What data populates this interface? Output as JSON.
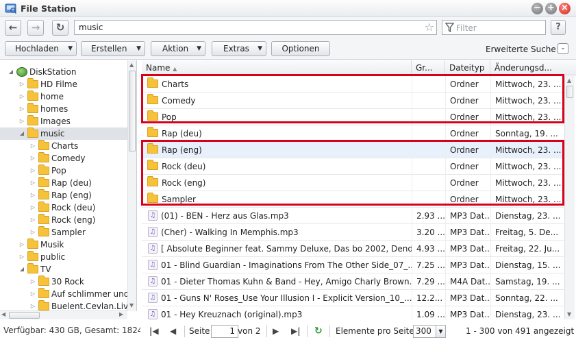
{
  "window": {
    "title": "File Station"
  },
  "nav": {
    "path": "music",
    "filter_placeholder": "Filter",
    "help": "?"
  },
  "toolbar": {
    "upload": "Hochladen",
    "create": "Erstellen",
    "action": "Aktion",
    "extras": "Extras",
    "options": "Optionen",
    "advanced_search": "Erweiterte Suche"
  },
  "tree": {
    "nodes": [
      {
        "label": "DiskStation",
        "level": 0,
        "expander": "◢",
        "icon": "diskstation-icon"
      },
      {
        "label": "HD Filme",
        "level": 1,
        "expander": "▷",
        "icon": "folder-icon"
      },
      {
        "label": "home",
        "level": 1,
        "expander": "▷",
        "icon": "folder-icon"
      },
      {
        "label": "homes",
        "level": 1,
        "expander": "▷",
        "icon": "folder-icon"
      },
      {
        "label": "Images",
        "level": 1,
        "expander": "▷",
        "icon": "folder-icon"
      },
      {
        "label": "music",
        "level": 1,
        "expander": "◢",
        "icon": "folder-open-icon",
        "selected": true
      },
      {
        "label": "Charts",
        "level": 2,
        "expander": "▷",
        "icon": "folder-icon"
      },
      {
        "label": "Comedy",
        "level": 2,
        "expander": "▷",
        "icon": "folder-icon"
      },
      {
        "label": "Pop",
        "level": 2,
        "expander": "▷",
        "icon": "folder-icon"
      },
      {
        "label": "Rap (deu)",
        "level": 2,
        "expander": "▷",
        "icon": "folder-icon"
      },
      {
        "label": "Rap (eng)",
        "level": 2,
        "expander": "▷",
        "icon": "folder-icon"
      },
      {
        "label": "Rock (deu)",
        "level": 2,
        "expander": "▷",
        "icon": "folder-icon"
      },
      {
        "label": "Rock (eng)",
        "level": 2,
        "expander": "▷",
        "icon": "folder-icon"
      },
      {
        "label": "Sampler",
        "level": 2,
        "expander": "▷",
        "icon": "folder-icon"
      },
      {
        "label": "Musik",
        "level": 1,
        "expander": "▷",
        "icon": "folder-icon"
      },
      {
        "label": "public",
        "level": 1,
        "expander": "▷",
        "icon": "folder-icon"
      },
      {
        "label": "TV",
        "level": 1,
        "expander": "◢",
        "icon": "folder-open-icon"
      },
      {
        "label": "30 Rock",
        "level": 2,
        "expander": "▷",
        "icon": "folder-icon"
      },
      {
        "label": "Auf schlimmer und e",
        "level": 2,
        "expander": "▷",
        "icon": "folder-icon"
      },
      {
        "label": "Buelent.Cevlan.Live",
        "level": 2,
        "expander": "▷",
        "icon": "folder-icon"
      }
    ]
  },
  "status": {
    "text": "Verfügbar: 430 GB, Gesamt: 1824"
  },
  "grid": {
    "headers": {
      "name": "Name",
      "size": "Gr...",
      "type": "Dateityp",
      "modified": "Änderungsd..."
    },
    "rows": [
      {
        "name": "Charts",
        "size": "",
        "type": "Ordner",
        "modified": "Mittwoch, 23. ...",
        "kind": "folder"
      },
      {
        "name": "Comedy",
        "size": "",
        "type": "Ordner",
        "modified": "Mittwoch, 23. ...",
        "kind": "folder"
      },
      {
        "name": "Pop",
        "size": "",
        "type": "Ordner",
        "modified": "Mittwoch, 23. ...",
        "kind": "folder"
      },
      {
        "name": "Rap (deu)",
        "size": "",
        "type": "Ordner",
        "modified": "Sonntag, 19. ...",
        "kind": "folder"
      },
      {
        "name": "Rap (eng)",
        "size": "",
        "type": "Ordner",
        "modified": "Mittwoch, 23. ...",
        "kind": "folder",
        "highlight": true
      },
      {
        "name": "Rock (deu)",
        "size": "",
        "type": "Ordner",
        "modified": "Mittwoch, 23. ...",
        "kind": "folder"
      },
      {
        "name": "Rock (eng)",
        "size": "",
        "type": "Ordner",
        "modified": "Mittwoch, 23. ...",
        "kind": "folder"
      },
      {
        "name": "Sampler",
        "size": "",
        "type": "Ordner",
        "modified": "Mittwoch, 23. ...",
        "kind": "folder"
      },
      {
        "name": "(01) - BEN - Herz aus Glas.mp3",
        "size": "2.93 ...",
        "type": "MP3 Dat...",
        "modified": "Dienstag, 23. ...",
        "kind": "music"
      },
      {
        "name": "(Cher) - Walking In Memphis.mp3",
        "size": "3.20 ...",
        "type": "MP3 Dat...",
        "modified": "Freitag, 5. De...",
        "kind": "music"
      },
      {
        "name": "[ Absolute Beginner feat. Sammy Deluxe, Das bo 2002, Dend...",
        "size": "4.93 ...",
        "type": "MP3 Dat...",
        "modified": "Freitag, 22. Ju...",
        "kind": "music"
      },
      {
        "name": "01 - Blind Guardian - Imaginations From The Other Side_07_...",
        "size": "7.25 ...",
        "type": "MP3 Dat...",
        "modified": "Dienstag, 15. ...",
        "kind": "music"
      },
      {
        "name": "01 - Dieter Thomas Kuhn & Band - Hey, Amigo Charly Brown...",
        "size": "7.29 ...",
        "type": "M4A Dat...",
        "modified": "Samstag, 19. ...",
        "kind": "music"
      },
      {
        "name": "01 - Guns N' Roses_Use Your Illusion I - Explicit Version_10_...",
        "size": "12.2...",
        "type": "MP3 Dat...",
        "modified": "Sonntag, 22. ...",
        "kind": "music"
      },
      {
        "name": "01 - Hey Kreuznach (original).mp3",
        "size": "1.09 ...",
        "type": "MP3 Dat...",
        "modified": "Dienstag, 23. ...",
        "kind": "music"
      }
    ]
  },
  "pager": {
    "page_label": "Seite",
    "page_value": "1",
    "of_label": "von 2",
    "per_page_label": "Elemente pro Seite",
    "per_page_value": "300",
    "range_text": "1 - 300 von 491 angezeigt"
  }
}
